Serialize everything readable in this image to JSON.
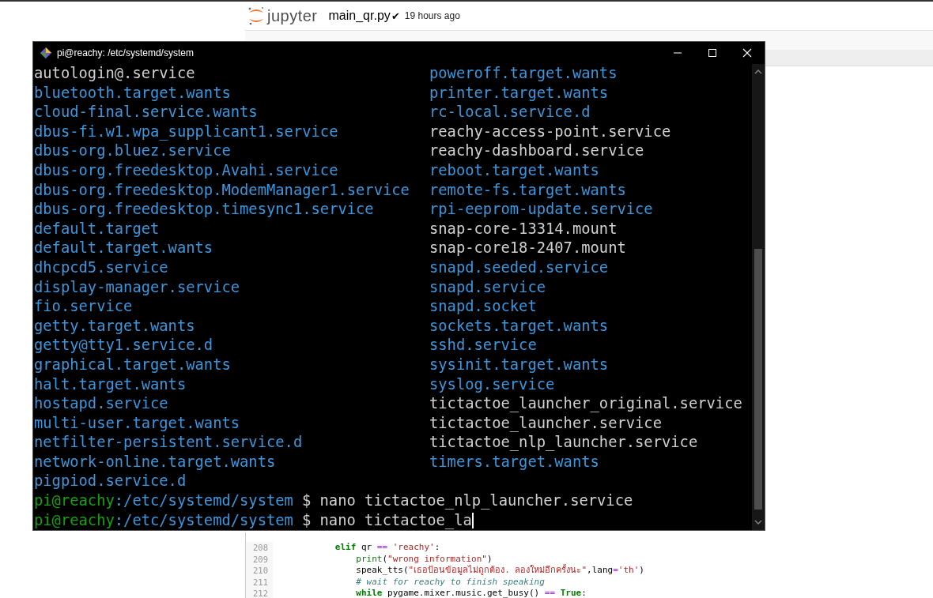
{
  "jupyter": {
    "logo_text": "jupyter",
    "filename": "main_qr.py",
    "saved_mark": "✔",
    "saved_time": "19 hours ago"
  },
  "terminal": {
    "title": "pi@reachy: /etc/systemd/system",
    "left": [
      {
        "name": "autologin@.service",
        "kind": "file"
      },
      {
        "name": "bluetooth.target.wants",
        "kind": "link"
      },
      {
        "name": "cloud-final.service.wants",
        "kind": "link"
      },
      {
        "name": "dbus-fi.w1.wpa_supplicant1.service",
        "kind": "link"
      },
      {
        "name": "dbus-org.bluez.service",
        "kind": "link"
      },
      {
        "name": "dbus-org.freedesktop.Avahi.service",
        "kind": "link"
      },
      {
        "name": "dbus-org.freedesktop.ModemManager1.service",
        "kind": "link"
      },
      {
        "name": "dbus-org.freedesktop.timesync1.service",
        "kind": "link"
      },
      {
        "name": "default.target",
        "kind": "link"
      },
      {
        "name": "default.target.wants",
        "kind": "link"
      },
      {
        "name": "dhcpcd5.service",
        "kind": "link"
      },
      {
        "name": "display-manager.service",
        "kind": "link"
      },
      {
        "name": "fio.service",
        "kind": "link"
      },
      {
        "name": "getty.target.wants",
        "kind": "link"
      },
      {
        "name": "getty@tty1.service.d",
        "kind": "link"
      },
      {
        "name": "graphical.target.wants",
        "kind": "link"
      },
      {
        "name": "halt.target.wants",
        "kind": "link"
      },
      {
        "name": "hostapd.service",
        "kind": "link"
      },
      {
        "name": "multi-user.target.wants",
        "kind": "link"
      },
      {
        "name": "netfilter-persistent.service.d",
        "kind": "link"
      },
      {
        "name": "network-online.target.wants",
        "kind": "link"
      },
      {
        "name": "pigpiod.service.d",
        "kind": "link"
      }
    ],
    "right": [
      {
        "name": "poweroff.target.wants",
        "kind": "link"
      },
      {
        "name": "printer.target.wants",
        "kind": "link"
      },
      {
        "name": "rc-local.service.d",
        "kind": "link"
      },
      {
        "name": "reachy-access-point.service",
        "kind": "file"
      },
      {
        "name": "reachy-dashboard.service",
        "kind": "file"
      },
      {
        "name": "reboot.target.wants",
        "kind": "link"
      },
      {
        "name": "remote-fs.target.wants",
        "kind": "link"
      },
      {
        "name": "rpi-eeprom-update.service",
        "kind": "link"
      },
      {
        "name": "snap-core-13314.mount",
        "kind": "file"
      },
      {
        "name": "snap-core18-2407.mount",
        "kind": "file"
      },
      {
        "name": "snapd.seeded.service",
        "kind": "link"
      },
      {
        "name": "snapd.service",
        "kind": "link"
      },
      {
        "name": "snapd.socket",
        "kind": "link"
      },
      {
        "name": "sockets.target.wants",
        "kind": "link"
      },
      {
        "name": "sshd.service",
        "kind": "link"
      },
      {
        "name": "sysinit.target.wants",
        "kind": "link"
      },
      {
        "name": "syslog.service",
        "kind": "link"
      },
      {
        "name": "tictactoe_launcher_original.service",
        "kind": "file"
      },
      {
        "name": "tictactoe_launcher.service",
        "kind": "file"
      },
      {
        "name": "tictactoe_nlp_launcher.service",
        "kind": "file"
      },
      {
        "name": "timers.target.wants",
        "kind": "link"
      }
    ],
    "prompts": [
      {
        "user": "pi@reachy",
        "path": ":/etc/systemd/system",
        "command": "$ nano tictactoe_nlp_launcher.service",
        "cursor": false
      },
      {
        "user": "pi@reachy",
        "path": ":/etc/systemd/system",
        "command": "$ nano tictactoe_la",
        "cursor": true
      }
    ]
  },
  "code": {
    "lines": [
      {
        "number": "208",
        "tokens": [
          {
            "text": "           elif",
            "kind": "keyword"
          },
          {
            "text": " qr ",
            "kind": "plain"
          },
          {
            "text": "==",
            "kind": "operator"
          },
          {
            "text": " 'reachy'",
            "kind": "string"
          },
          {
            "text": ":",
            "kind": "plain"
          }
        ]
      },
      {
        "number": "209",
        "tokens": [
          {
            "text": "               print",
            "kind": "builtin"
          },
          {
            "text": "(",
            "kind": "plain"
          },
          {
            "text": "\"wrong information\"",
            "kind": "string"
          },
          {
            "text": ")",
            "kind": "plain"
          }
        ]
      },
      {
        "number": "210",
        "tokens": [
          {
            "text": "               speak_tts(",
            "kind": "plain"
          },
          {
            "text": "\"เธอป้อนข้อมูลไม่ถูกต้อง. ลองใหม่อีกครั้งนะ\"",
            "kind": "string"
          },
          {
            "text": ",lang",
            "kind": "plain"
          },
          {
            "text": "=",
            "kind": "operator"
          },
          {
            "text": "'th'",
            "kind": "string"
          },
          {
            "text": ")",
            "kind": "plain"
          }
        ]
      },
      {
        "number": "211",
        "tokens": [
          {
            "text": "               # wait for reachy to finish speaking",
            "kind": "comment"
          }
        ]
      },
      {
        "number": "212",
        "tokens": [
          {
            "text": "               while",
            "kind": "keyword"
          },
          {
            "text": " pygame.mixer.music.get_busy() ",
            "kind": "plain"
          },
          {
            "text": "==",
            "kind": "operator"
          },
          {
            "text": " True",
            "kind": "keyword"
          },
          {
            "text": ":",
            "kind": "plain"
          }
        ]
      }
    ]
  }
}
